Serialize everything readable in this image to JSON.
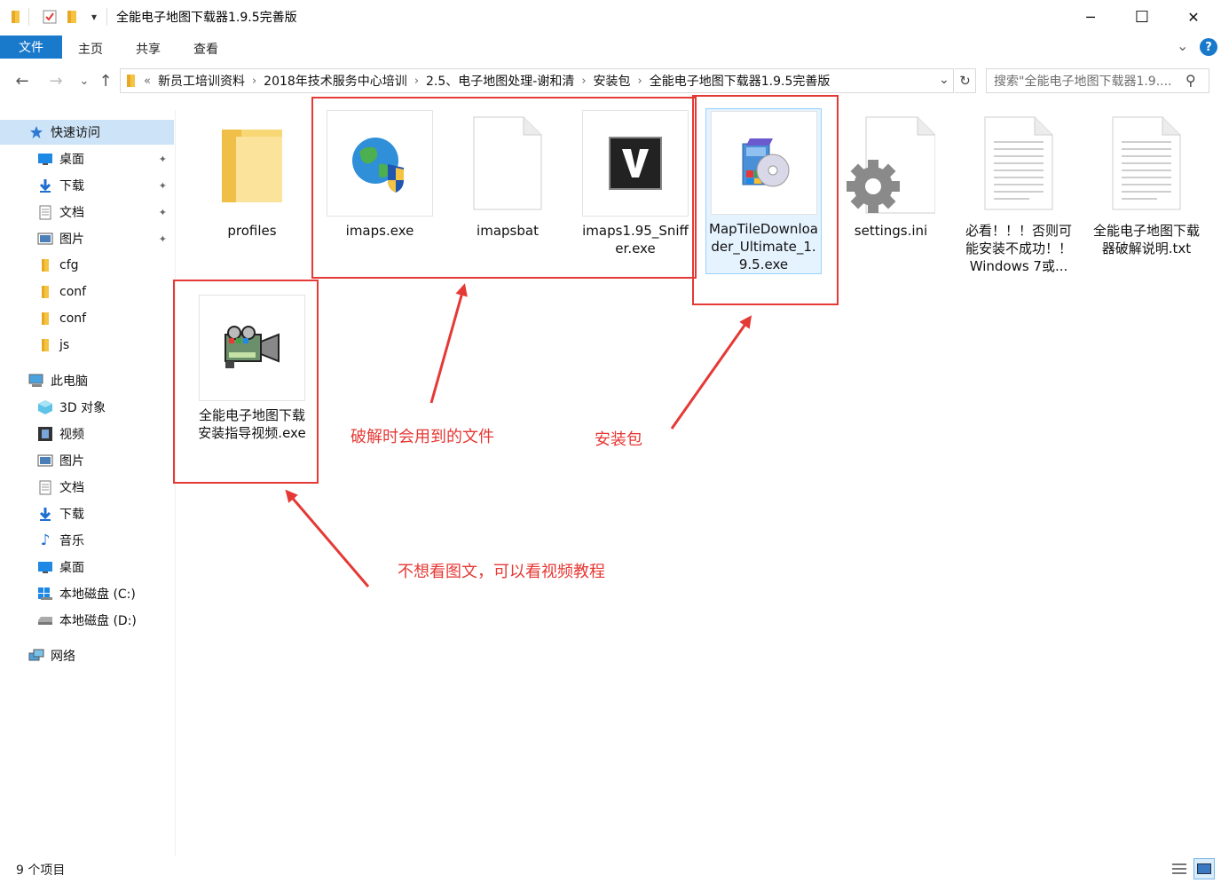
{
  "window": {
    "title": "全能电子地图下载器1.9.5完善版",
    "minimize_glyph": "─",
    "maximize_glyph": "☐",
    "close_glyph": "✕",
    "quick_access_dropdown_glyph": "▾"
  },
  "ribbon": {
    "tabs": [
      "文件",
      "主页",
      "共享",
      "查看"
    ],
    "expand_glyph": "⌄",
    "help_glyph": "?"
  },
  "nav": {
    "back_glyph": "←",
    "forward_glyph": "→",
    "recent_glyph": "⌄",
    "up_glyph": "↑",
    "overflow_glyph": "«",
    "separator_glyph": "›",
    "dropdown_glyph": "⌄",
    "refresh_glyph": "↻",
    "breadcrumbs": [
      "新员工培训资料",
      "2018年技术服务中心培训",
      "2.5、电子地图处理-谢和清",
      "安装包",
      "全能电子地图下载器1.9.5完善版"
    ],
    "search_placeholder": "搜索\"全能电子地图下载器1.9....",
    "search_glyph": "⚲"
  },
  "sidebar": {
    "quick_access": "快速访问",
    "quick_items": [
      {
        "label": "桌面",
        "icon": "desktop-icon",
        "pinned": true
      },
      {
        "label": "下载",
        "icon": "download-icon",
        "pinned": true
      },
      {
        "label": "文档",
        "icon": "document-icon",
        "pinned": true
      },
      {
        "label": "图片",
        "icon": "pictures-icon",
        "pinned": true
      },
      {
        "label": "cfg",
        "icon": "folder-icon",
        "pinned": false
      },
      {
        "label": "conf",
        "icon": "folder-icon",
        "pinned": false
      },
      {
        "label": "conf",
        "icon": "folder-icon",
        "pinned": false
      },
      {
        "label": "js",
        "icon": "folder-icon",
        "pinned": false
      }
    ],
    "this_pc": "此电脑",
    "pc_items": [
      {
        "label": "3D 对象",
        "icon": "3d-objects-icon"
      },
      {
        "label": "视频",
        "icon": "video-icon"
      },
      {
        "label": "图片",
        "icon": "pictures-icon"
      },
      {
        "label": "文档",
        "icon": "document-icon"
      },
      {
        "label": "下载",
        "icon": "download-icon"
      },
      {
        "label": "音乐",
        "icon": "music-icon"
      },
      {
        "label": "桌面",
        "icon": "desktop-icon"
      },
      {
        "label": "本地磁盘 (C:)",
        "icon": "drive-c-icon"
      },
      {
        "label": "本地磁盘 (D:)",
        "icon": "drive-d-icon"
      }
    ],
    "network": "网络",
    "pin_glyph": "📌"
  },
  "files": [
    {
      "name": "profiles",
      "icon": "folder-icon"
    },
    {
      "name": "imaps.exe",
      "icon": "globe-shield-icon"
    },
    {
      "name": "imapsbat",
      "icon": "blank-file-icon"
    },
    {
      "name": "imaps1.95_Sniffer.exe",
      "icon": "v-logo-icon"
    },
    {
      "name": "MapTileDownloader_Ultimate_1.9.5.exe",
      "icon": "installer-icon",
      "selected": true
    },
    {
      "name": "settings.ini",
      "icon": "settings-file-icon"
    },
    {
      "name": "必看！！！否则可能安装不成功！！Windows 7或...",
      "icon": "text-file-icon"
    },
    {
      "name": "全能电子地图下载器破解说明.txt",
      "icon": "text-file-icon"
    },
    {
      "name": "全能电子地图下载安装指导视频.exe",
      "icon": "video-camera-icon"
    }
  ],
  "annotations": {
    "crack_files": "破解时会用到的文件",
    "installer": "安装包",
    "video": "不想看图文，可以看视频教程",
    "color": "#e53935"
  },
  "status": {
    "item_count": "9 个项目"
  },
  "colors": {
    "accent": "#1979ca",
    "selection": "#cde3f7",
    "annotation": "#e53935"
  }
}
